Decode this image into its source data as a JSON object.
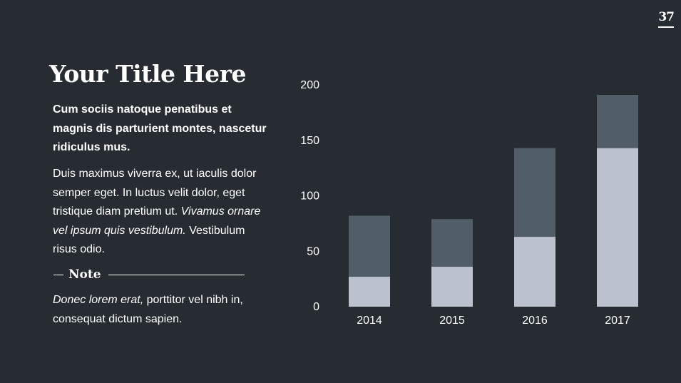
{
  "page_number": "37",
  "title": "Your Title Here",
  "lead": "Cum sociis natoque penatibus et magnis dis parturient montes, nascetur ridiculus mus.",
  "body": {
    "part1": "Duis maximus viverra ex, ut iaculis dolor semper eget. In luctus velit dolor, eget tristique diam pretium ut. ",
    "italic": "Vivamus ornare vel ipsum quis vestibulum.",
    "part2": " Vestibulum risus odio."
  },
  "note": {
    "label": "Note",
    "italic": "Donec lorem erat,",
    "text": " porttitor vel nibh in, consequat dictum sapien."
  },
  "chart_data": {
    "type": "bar",
    "stacked": true,
    "categories": [
      "2014",
      "2015",
      "2016",
      "2017"
    ],
    "series": [
      {
        "values": [
          27,
          36,
          63,
          143
        ],
        "color": "#bbc1cd"
      },
      {
        "values": [
          55,
          43,
          80,
          48
        ],
        "color": "#525e67"
      }
    ],
    "ylim": [
      0,
      200
    ],
    "yticks": [
      0,
      50,
      100,
      150,
      200
    ],
    "grid": false,
    "title": "",
    "xlabel": "",
    "ylabel": ""
  }
}
